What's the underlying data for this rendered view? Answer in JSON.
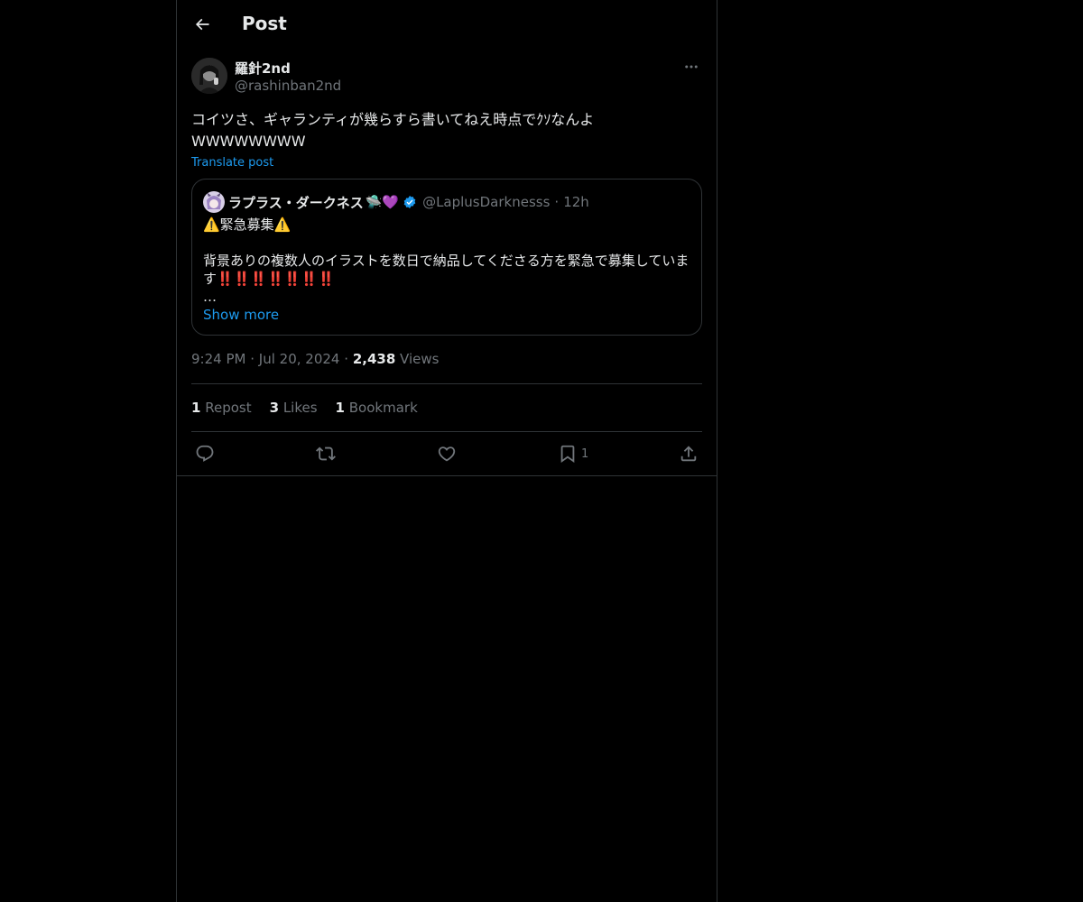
{
  "header": {
    "title": "Post"
  },
  "post": {
    "author_name": "羅針2nd",
    "author_handle": "@rashinban2nd",
    "text": "コイツさ、ギャランティが幾らすら書いてねえ時点でｸｿなんよ\nWWWWWWWW",
    "translate_label": "Translate post",
    "quote": {
      "name": "ラプラス・ダークネス",
      "name_emoji": "🛸💜",
      "handle": "@LaplusDarknesss",
      "separator": "·",
      "time": "12h",
      "line1": "⚠️緊急募集⚠️",
      "line2": "背景ありの複数人のイラストを数日で納品してくださる方を緊急で募集していま",
      "line3_text": "す",
      "line3_marks": "‼️‼️‼️‼️‼️‼️‼️",
      "ellipsis": "…",
      "show_more": "Show more"
    },
    "time": "9:24 PM",
    "dot": "·",
    "date": "Jul 20, 2024",
    "views_count": "2,438",
    "views_label": "Views",
    "reposts_count": "1",
    "reposts_label": "Repost",
    "likes_count": "3",
    "likes_label": "Likes",
    "bookmarks_count": "1",
    "bookmarks_label": "Bookmark",
    "bookmark_action_count": "1"
  },
  "colors": {
    "background": "#000000",
    "accent": "#1d9bf0",
    "muted": "#71767b",
    "border": "#2f3336"
  },
  "icons": [
    "back-arrow-icon",
    "more-icon",
    "verified-badge-icon",
    "reply-icon",
    "repost-icon",
    "like-icon",
    "bookmark-icon",
    "share-icon"
  ]
}
